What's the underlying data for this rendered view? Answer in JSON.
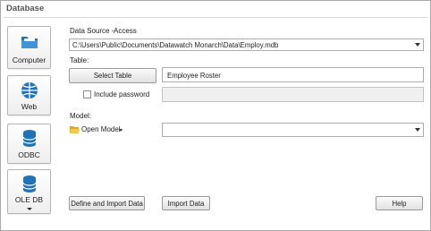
{
  "section_title": "Database",
  "sources": [
    {
      "label": "Computer",
      "icon": "folder-icon"
    },
    {
      "label": "Web",
      "icon": "globe-icon"
    },
    {
      "label": "ODBC",
      "icon": "odbc-database-icon"
    },
    {
      "label": "OLE DB",
      "icon": "oledb-database-icon"
    }
  ],
  "data_source": {
    "label": "Data Source -",
    "type": "Access",
    "path": "C:\\Users\\Public\\Documents\\Datawatch Monarch\\Data\\Employ.mdb"
  },
  "table": {
    "label": "Table:",
    "select_button": "Select Table",
    "value": "Employee Roster"
  },
  "password": {
    "checkbox_label": "Include password",
    "checked": false,
    "value": ""
  },
  "model": {
    "label": "Model:",
    "open_label": "Open Model",
    "value": ""
  },
  "buttons": {
    "define_import": "Define and Import Data",
    "import": "Import Data",
    "help": "Help"
  },
  "colors": {
    "accent_blue": "#1f73b7",
    "folder_yellow": "#f2c94c"
  }
}
